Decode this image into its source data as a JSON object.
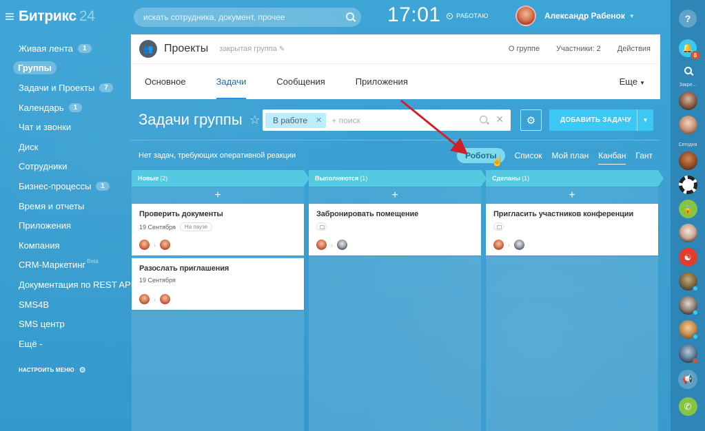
{
  "app": {
    "logo_name": "Битрикс",
    "logo_num": "24"
  },
  "sidebar": {
    "items": [
      {
        "label": "Живая лента",
        "badge": "1"
      },
      {
        "label": "Группы",
        "badge": ""
      },
      {
        "label": "Задачи и Проекты",
        "badge": "7"
      },
      {
        "label": "Календарь",
        "badge": "1"
      },
      {
        "label": "Чат и звонки",
        "badge": ""
      },
      {
        "label": "Диск",
        "badge": ""
      },
      {
        "label": "Сотрудники",
        "badge": ""
      },
      {
        "label": "Бизнес-процессы",
        "badge": "1"
      },
      {
        "label": "Время и отчеты",
        "badge": ""
      },
      {
        "label": "Приложения",
        "badge": ""
      },
      {
        "label": "Компания",
        "badge": ""
      },
      {
        "label": "CRM-Маркетинг",
        "badge": "",
        "beta": "Beta"
      },
      {
        "label": "Документация по REST API",
        "badge": ""
      },
      {
        "label": "SMS4B",
        "badge": ""
      },
      {
        "label": "SMS центр",
        "badge": ""
      },
      {
        "label": "Ещё -",
        "badge": ""
      }
    ],
    "settings_label": "НАСТРОИТЬ МЕНЮ"
  },
  "header": {
    "search_placeholder": "искать сотрудника, документ, прочее",
    "clock": "17:01",
    "work_status": "РАБОТАЮ",
    "user_name": "Александр Рабенок"
  },
  "project": {
    "title": "Проекты",
    "type": "закрытая группа",
    "links": [
      "О группе",
      "Участники: 2",
      "Действия"
    ],
    "tabs": [
      "Основное",
      "Задачи",
      "Сообщения",
      "Приложения"
    ],
    "active_tab": "Задачи",
    "more": "Еще"
  },
  "tasks": {
    "title": "Задачи группы",
    "filter_chip": "В работе",
    "filter_placeholder": "+ поиск",
    "add_button": "ДОБАВИТЬ ЗАДАЧУ",
    "no_tasks": "Нет задач, требующих оперативной реакции",
    "views": [
      "Роботы",
      "Список",
      "Мой план",
      "Канбан",
      "Гант"
    ],
    "active_view": "Канбан"
  },
  "kanban": {
    "columns": [
      {
        "title": "Новые",
        "count": "(2)",
        "color": "#55c9e2",
        "cards": [
          {
            "title": "Проверить документы",
            "date": "19 Сентября",
            "status": "На паузе"
          },
          {
            "title": "Разослать приглашения",
            "date": "19 Сентября",
            "status": ""
          }
        ]
      },
      {
        "title": "Выполняются",
        "count": "(1)",
        "color": "#55c9e2",
        "cards": [
          {
            "title": "Забронировать помещение",
            "date": "",
            "status": ""
          }
        ]
      },
      {
        "title": "Сделаны",
        "count": "(1)",
        "color": "#55c9e2",
        "cards": [
          {
            "title": "Пригласить участников конференции",
            "date": "",
            "status": ""
          }
        ]
      }
    ]
  },
  "rail": {
    "help": "?",
    "notifications_count": "8",
    "label_favorites": "Закре...",
    "label_today": "Сегодня"
  },
  "colors": {
    "accent": "#3bc8f5",
    "background": "#3a9fd0",
    "arrow": "#d0202a",
    "badge_red": "#f54819"
  }
}
